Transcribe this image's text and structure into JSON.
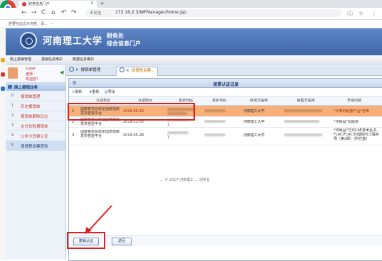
{
  "browser": {
    "tab_title": "财务信息门户",
    "close_glyph": "×",
    "newtab_glyph": "+",
    "security_label": "不安全",
    "url": "172.16.2.3/WFManager/home.jsp",
    "bookmark_hint": "若要在此显示书签，请...",
    "bookmark_link": "...",
    "nav_back": "←",
    "nav_forward": "→",
    "nav_reload": "C",
    "nav_home": "⌂",
    "nav_undo": "↶",
    "nav_redo": "↷",
    "nav_lock": "ⓘ",
    "star": "☆",
    "more": "⋮"
  },
  "header": {
    "university": "河南理工大学",
    "system_line1": "财务处",
    "system_line2": "综合信息门户"
  },
  "menu": [
    "网上报销管理",
    "报销信息维护",
    "数据信息维护"
  ],
  "user": {
    "line1": "super",
    "line2": "老师",
    "line3": "欢迎您！",
    "collapse_glyph": "◀"
  },
  "sidebar": {
    "section": "网上报销业务",
    "items": [
      {
        "num": "0",
        "label": "报销单管理"
      },
      {
        "num": "1",
        "label": "历史报销单"
      },
      {
        "num": "2",
        "label": "报销单删除日志"
      },
      {
        "num": "3",
        "label": "支付失败报销单"
      },
      {
        "num": "4",
        "label": "公务卡消费认证"
      },
      {
        "num": "5",
        "label": "增值税发票查验"
      }
    ]
  },
  "content_tabs": [
    {
      "label": "报销单管理"
    },
    {
      "label": "增值税发票..."
    }
  ],
  "panel": {
    "title": "发票认证记录",
    "menu_glyph": "☰",
    "toolbar": [
      "刷新",
      "重新",
      "导出"
    ],
    "columns": [
      "认证单位",
      "认证时间",
      "发票代码",
      "发票号码",
      "购买方名称",
      "销售方名称",
      "开票内容"
    ],
    "rows": [
      {
        "num": "1",
        "unit": "国家税务总局全国增值税发票查验平台",
        "time": "2020-05-13",
        "buyer": "河南理工大学",
        "content": "*计算机配套产品*色带",
        "selected": true
      },
      {
        "num": "2",
        "unit": "国家税务总局全国增值税发票查验平台",
        "time": "2019-12-05",
        "code_tail": "1",
        "buyer": "河南理工大学",
        "content": "*印刷品*出版费",
        "selected": false
      },
      {
        "num": "3",
        "unit": "国家税务总局全国增值税发票查验平台",
        "time": "2019-05-28",
        "code_tail": "1",
        "buyer": "河南理工大学",
        "content": "*印刷品*万元CAE技术丛书 FLAC/FLAC3D基础与工程实例（第2版）(附光盘)",
        "selected": false
      }
    ],
    "buttons": {
      "cancel_auth": "撤销认证",
      "back": "返回"
    }
  },
  "copyright": "... © 2017 河南理工 ... 财务处"
}
